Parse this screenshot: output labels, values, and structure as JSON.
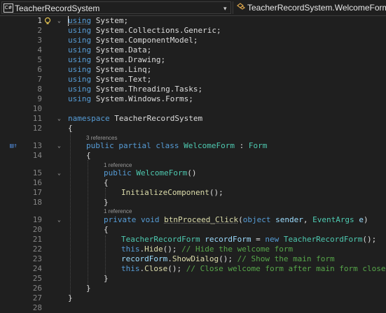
{
  "toolbar": {
    "project_badge": "C#",
    "project_dropdown": "TeacherRecordSystem",
    "member_dropdown": "TeacherRecordSystem.WelcomeForm",
    "caret": "▾"
  },
  "editor": {
    "line_numbers": [
      "1",
      "2",
      "3",
      "4",
      "5",
      "6",
      "7",
      "8",
      "9",
      "10",
      "11",
      "12",
      "13",
      "14",
      "15",
      "16",
      "17",
      "18",
      "19",
      "20",
      "21",
      "22",
      "23",
      "24",
      "25",
      "26",
      "27",
      "28"
    ],
    "references": {
      "class_refs": "3 references",
      "ctor_refs": "1 reference",
      "method_refs": "1 reference"
    },
    "tokens": {
      "using": "using",
      "system": "System",
      "semi": ";",
      "collections": "System.Collections.Generic",
      "componentmodel": "System.ComponentModel",
      "data": "System.Data",
      "drawing": "System.Drawing",
      "linq": "System.Linq",
      "text": "System.Text",
      "threading": "System.Threading.Tasks",
      "winforms": "System.Windows.Forms",
      "namespace": "namespace",
      "ns_name": "TeacherRecordSystem",
      "open_brace": "{",
      "close_brace": "}",
      "public": "public",
      "partial": "partial",
      "class": "class",
      "class_name": "WelcomeForm",
      "colon": " : ",
      "base": "Form",
      "ctor": "WelcomeForm",
      "parens": "()",
      "init": "InitializeComponent",
      "call_end": "();",
      "private": "private",
      "void": "void",
      "method": "btnProceed_Click",
      "object": "object",
      "sender": "sender",
      "comma": ", ",
      "eventargs": "EventArgs",
      "e": "e",
      "paren_open": "(",
      "paren_close": ")",
      "trf": "TeacherRecordForm",
      "recordform": "recordForm",
      "assign_new": " = ",
      "new": "new",
      "this": "this",
      "hide": "Hide",
      "showdialog": "ShowDialog",
      "close": "Close",
      "dot": ".",
      "space": " ",
      "comment_hide": "// Hide the welcome form",
      "comment_show": "// Show the main form",
      "comment_close": "// Close welcome form after main form closes"
    }
  },
  "colors": {
    "keyword": "#569cd6",
    "type": "#4ec9b0",
    "method": "#dcdcaa",
    "parameter": "#9cdcfe",
    "comment": "#57a64a",
    "background": "#1f1f1f"
  }
}
